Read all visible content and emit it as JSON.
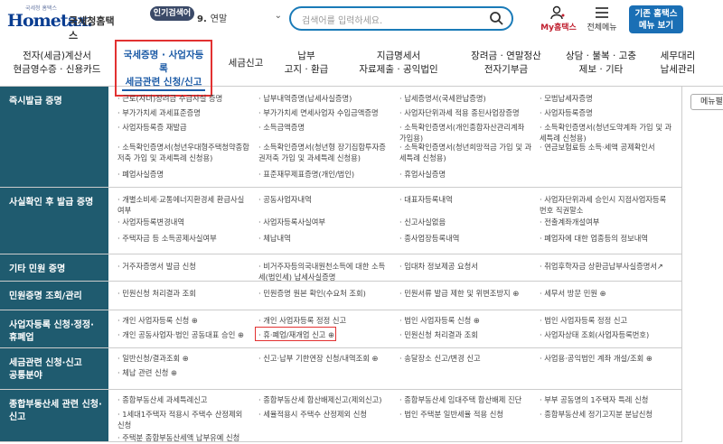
{
  "header": {
    "logo_small": "국세청 홈택스",
    "logo_home": "Hometax.",
    "logo_cheong": "국세청홈택스",
    "popular_badge": "인기검색어",
    "popular_num": "9.",
    "popular_term": "연말",
    "search_placeholder": "검색어를 입력하세요.",
    "my_label": "My홈택스",
    "menu_label": "전체메뉴",
    "old_menu": [
      "기존 홈택스",
      "메뉴 보기"
    ]
  },
  "gnb": [
    [
      "전자(세금)계산서",
      "현금영수증 · 신용카드"
    ],
    [
      "국세증명 · 사업자등록",
      "세금관련 신청/신고"
    ],
    [
      "세금신고"
    ],
    [
      "납부",
      "고지 · 환급"
    ],
    [
      "지급명세서",
      "자료제출 · 공익법인"
    ],
    [
      "장려금 · 연말정산",
      "전자기부금"
    ],
    [
      "상담 · 불복 · 고충",
      "제보 · 기타"
    ],
    [
      "세무대리",
      "납세관리"
    ]
  ],
  "side_button": "메뉴펼침",
  "rows": [
    {
      "title": [
        "즉시발급 증명"
      ],
      "cells": [
        [
          "· 근로(자녀)장려금 수급사실 증명"
        ],
        [
          "· 납부내역증명(납세사실증명)"
        ],
        [
          "· 납세증명서(국세완납증명)"
        ],
        [
          "· 모범납세자증명"
        ],
        [
          "· 부가가치세 과세표준증명"
        ],
        [
          "· 부가가치세 면세사업자 수입금액증명"
        ],
        [
          "· 사업자단위과세 적용 종된사업장증명"
        ],
        [
          "· 사업자등록증명"
        ],
        [
          "· 사업자등록증 재발급"
        ],
        [
          "· 소득금액증명"
        ],
        [
          "· 소득확인증명서(개인종합자산관리계좌",
          "  가입용)"
        ],
        [
          "· 소득확인증명서(청년도약계좌 가입 및 과",
          "  세특례 신청용)"
        ],
        [
          "· 소득확인증명서(청년우대형주택청약종합",
          "  저축 가입 및 과세특례 신청용)"
        ],
        [
          "· 소득확인증명서(청년형 장기집합투자증",
          "  권저축 가입 및 과세특례 신청용)"
        ],
        [
          "· 소득확인증명서(청년희망적금 가입 및 과",
          "  세특례 신청용)"
        ],
        [
          "· 연금보험료등 소득·세액 공제확인서"
        ],
        [
          "· 폐업사실증명"
        ],
        [
          "· 표준재무제표증명(개인/법인)"
        ],
        [
          "· 휴업사실증명"
        ],
        [
          ""
        ]
      ]
    },
    {
      "title": [
        "사실확인 후 발급 증명"
      ],
      "cells": [
        [
          "· 개별소비세·교통에너지환경세 환급사실",
          "  여부"
        ],
        [
          "· 공동사업자내역"
        ],
        [
          "· 대표자등록내역"
        ],
        [
          "· 사업자단위과세 승인시 지점사업자등록",
          "  번호 직권말소"
        ],
        [
          "· 사업자등록변경내역"
        ],
        [
          "· 사업자등록사실여부"
        ],
        [
          "· 신고사실없음"
        ],
        [
          "· 전출계좌개설여부"
        ],
        [
          "· 주택자금 등 소득공제사실여부"
        ],
        [
          "· 체납내역"
        ],
        [
          "· 종사업장등록내역"
        ],
        [
          "· 폐업자에 대한 업종등의 정보내역"
        ]
      ]
    },
    {
      "title": [
        "기타 민원 증명"
      ],
      "cells": [
        [
          "· 거주자증명서 발급 신청"
        ],
        [
          "· 비거주자등의국내원천소득에 대한 소득",
          "  세(법인세) 납세사실증명"
        ],
        [
          "· 임대차 정보제공 요청서"
        ],
        [
          "· 취업후학자금 상환금납부사실증명서↗"
        ]
      ]
    },
    {
      "title": [
        "민원증명 조회/관리"
      ],
      "cells": [
        [
          "· 민원신청 처리결과 조회"
        ],
        [
          "· 민원증명 원본 확인(수요처 조회)"
        ],
        [
          "· 민원서류 발급 제한 및 위변조방지 ⊕"
        ],
        [
          "· 세무서 방문 민원 ⊕"
        ]
      ]
    },
    {
      "title": [
        "사업자등록 신청·정정·",
        "휴폐업"
      ],
      "cells": [
        [
          "· 개인 사업자등록 신청 ⊕"
        ],
        [
          "· 개인 사업자등록 정정 신고"
        ],
        [
          "· 법인 사업자등록 신청 ⊕"
        ],
        [
          "· 법인 사업자등록 정정 신고"
        ],
        [
          "· 개인 공동사업자·법인 공동대표 승인 ⊕"
        ],
        [
          "· 휴·폐업/재개업 신고 ⊕"
        ],
        [
          "· 민원신청 처리결과 조회"
        ],
        [
          "· 사업자상태 조회(사업자등록번호)"
        ]
      ]
    },
    {
      "title": [
        "세금관련 신청·신고",
        "공통분야"
      ],
      "cells": [
        [
          "· 일반신청/결과조회 ⊕"
        ],
        [
          "· 신고·납부 기한연장 신청/내역조회 ⊕"
        ],
        [
          "· 송달장소 신고/변경 신고"
        ],
        [
          "· 사업용·공익법인 계좌 개설/조회 ⊕"
        ],
        [
          "· 체납 관련 신청 ⊕"
        ],
        [
          ""
        ],
        [
          ""
        ],
        [
          ""
        ]
      ]
    },
    {
      "title": [
        "종합부동산세 관련 신청·",
        "신고"
      ],
      "cells": [
        [
          "· 종합부동산세 과세특례신고"
        ],
        [
          "· 종합부동산세 합산배제신고(제외신고)"
        ],
        [
          "· 종합부동산세 임대주택 합산배제 진단"
        ],
        [
          "· 부부 공동명의 1주택자 특례 신청"
        ],
        [
          "· 1세대1주택자 적용시 주택수 산정제외",
          "  신청"
        ],
        [
          "· 세율적용시 주택수 산정제외 신청"
        ],
        [
          "· 법인 주택분 일반세율 적용 신청"
        ],
        [
          "· 종합부동산세 정기고지분 분납신청"
        ],
        [
          "· 주택분 종합부동산세액 납부유예 신청"
        ],
        [
          ""
        ],
        [
          ""
        ],
        [
          ""
        ]
      ]
    }
  ]
}
